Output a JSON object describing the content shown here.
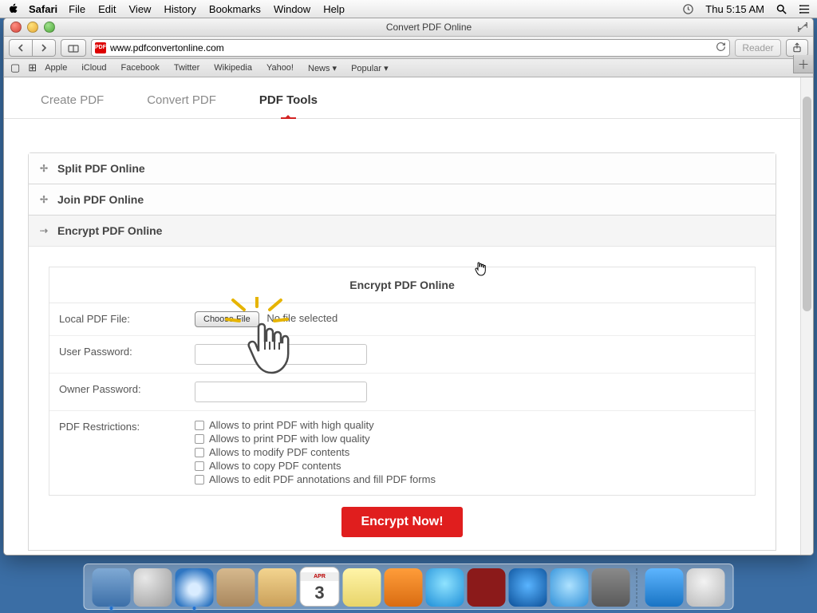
{
  "menubar": {
    "app": "Safari",
    "items": [
      "File",
      "Edit",
      "View",
      "History",
      "Bookmarks",
      "Window",
      "Help"
    ],
    "clock": "Thu 5:15 AM"
  },
  "window": {
    "title": "Convert PDF Online",
    "url": "www.pdfconvertonline.com",
    "reader_label": "Reader"
  },
  "bookmarks": [
    "Apple",
    "iCloud",
    "Facebook",
    "Twitter",
    "Wikipedia",
    "Yahoo!",
    "News ▾",
    "Popular ▾"
  ],
  "sitenav": {
    "items": [
      {
        "label": "Create PDF",
        "active": false
      },
      {
        "label": "Convert PDF",
        "active": false
      },
      {
        "label": "PDF Tools",
        "active": true
      }
    ]
  },
  "accordion": {
    "items": [
      {
        "label": "Split PDF Online",
        "open": false
      },
      {
        "label": "Join PDF Online",
        "open": false
      },
      {
        "label": "Encrypt PDF Online",
        "open": true
      }
    ]
  },
  "encrypt": {
    "title": "Encrypt PDF Online",
    "rows": {
      "file": {
        "label": "Local PDF File:",
        "button": "Choose File",
        "status": "No file selected"
      },
      "userpw": {
        "label": "User Password:"
      },
      "ownerpw": {
        "label": "Owner Password:"
      },
      "restrictions": {
        "label": "PDF Restrictions:",
        "options": [
          "Allows to print PDF with high quality",
          "Allows to print PDF with low quality",
          "Allows to modify PDF contents",
          "Allows to copy PDF contents",
          "Allows to edit PDF annotations and fill PDF forms"
        ]
      }
    },
    "submit": "Encrypt Now!"
  },
  "calendar": {
    "month": "APR",
    "day": "3"
  }
}
